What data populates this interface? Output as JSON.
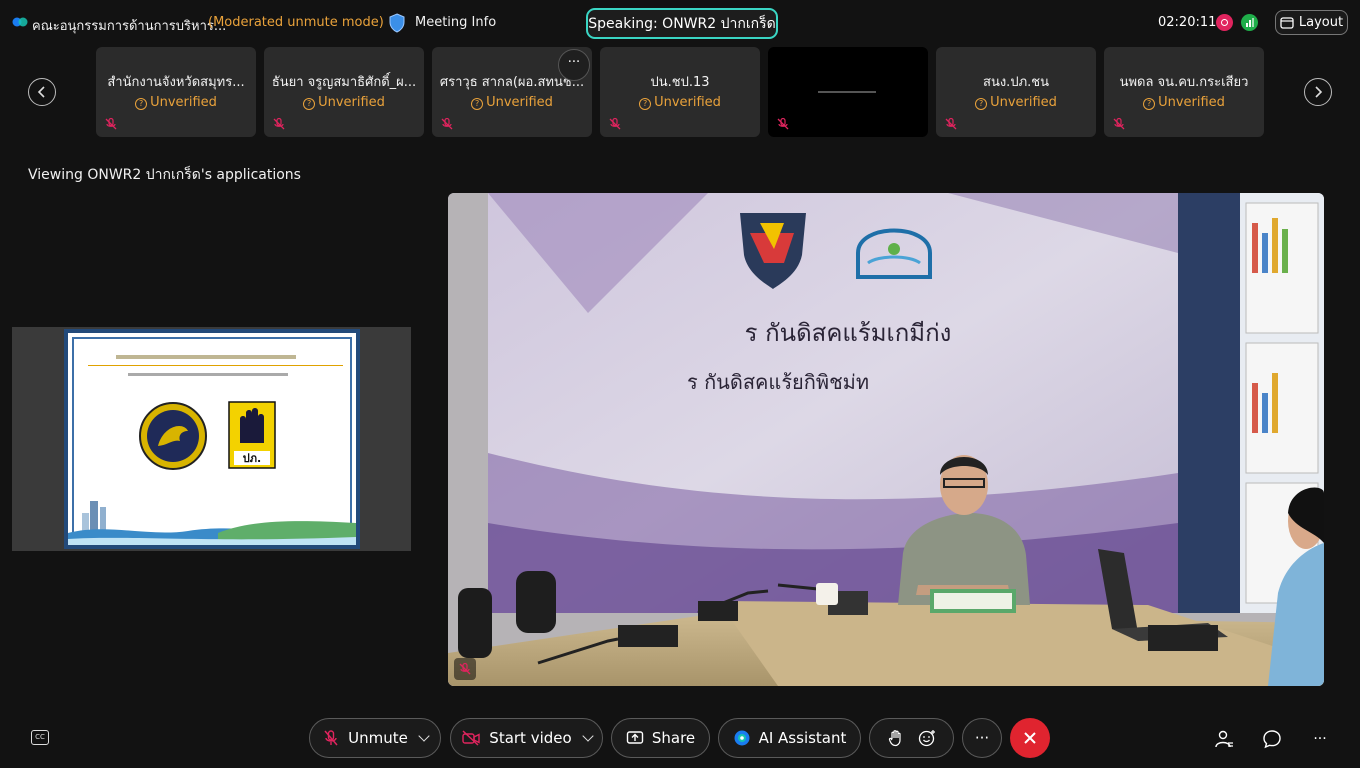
{
  "header": {
    "meeting_title": "คณะอนุกรรมการด้านการบริหาร...",
    "mode": "(Moderated unmute mode)",
    "meeting_info": "Meeting Info",
    "speaking": "Speaking: ONWR2 ปากเกร็ด",
    "clock": "02:20:11",
    "layout": "Layout"
  },
  "participants": [
    {
      "name": "สำนักงานจังหวัดสมุทร...",
      "status": "Unverified"
    },
    {
      "name": "ธันยา จรูญสมาธิศักดิ์_ผ...",
      "status": "Unverified"
    },
    {
      "name": "ศราวุธ สากล(ผอ.สทนช...",
      "status": "Unverified"
    },
    {
      "name": "ปน.ชป.13",
      "status": "Unverified"
    },
    {
      "name": "",
      "status": ""
    },
    {
      "name": "สนง.ปภ.ชน",
      "status": "Unverified"
    },
    {
      "name": "นพดล จน.คบ.กระเสียว",
      "status": "Unverified"
    }
  ],
  "viewing_label": "Viewing ONWR2 ปากเกร็ด's applications",
  "video": {
    "sign_line1": "ร กันดิสคแร้มเกมีก่ง",
    "sign_line2": "ร กันดิสคแร้ยกิพิชม่ท"
  },
  "toolbar": {
    "unmute": "Unmute",
    "start_video": "Start video",
    "share": "Share",
    "ai_assistant": "AI Assistant",
    "more": "···"
  },
  "colors": {
    "accent_teal": "#3ad6c4",
    "warning_orange": "#e9a23b",
    "end_red": "#e0242f"
  }
}
